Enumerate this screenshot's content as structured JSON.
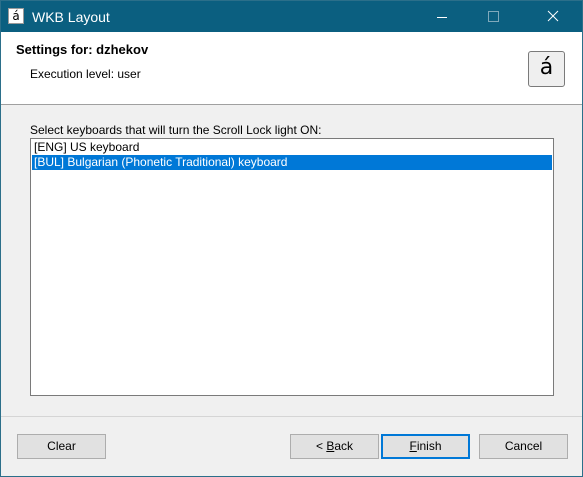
{
  "window": {
    "title": "WKB Layout",
    "icon_glyph": "á",
    "icon_name": "app-icon",
    "titlebar_color": "#0b5f80"
  },
  "header": {
    "settings_title": "Settings for: dzhekov",
    "execution_level": "Execution level: user",
    "app_button_glyph": "á"
  },
  "main": {
    "instruction": "Select keyboards that will turn the Scroll Lock light ON:",
    "keyboards": [
      {
        "label": "[ENG] US keyboard",
        "selected": false
      },
      {
        "label": "[BUL] Bulgarian (Phonetic Traditional) keyboard",
        "selected": true
      }
    ],
    "selection_color": "#0078d7"
  },
  "footer": {
    "clear_label": "Clear",
    "back_prefix": "< ",
    "back_mnemonic": "B",
    "back_rest": "ack",
    "finish_mnemonic": "F",
    "finish_rest": "inish",
    "cancel_label": "Cancel"
  }
}
